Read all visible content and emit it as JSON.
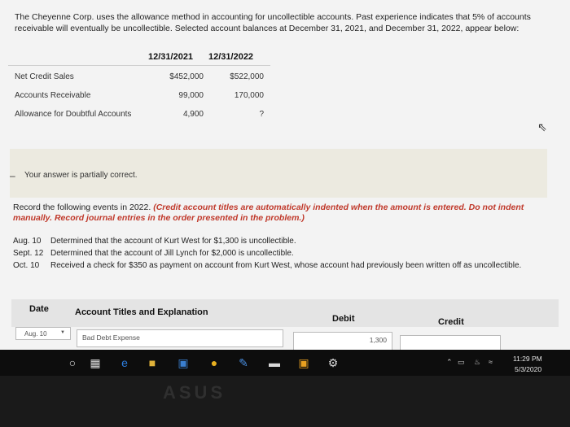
{
  "intro": "The Cheyenne Corp. uses the allowance method in accounting for uncollectible accounts. Past experience indicates that 5% of accounts receivable will eventually be uncollectible. Selected account balances at December 31, 2021, and December 31, 2022, appear below:",
  "balances": {
    "headers": [
      "12/31/2021",
      "12/31/2022"
    ],
    "rows": [
      {
        "label": "Net Credit Sales",
        "v2021": "$452,000",
        "v2022": "$522,000"
      },
      {
        "label": "Accounts Receivable",
        "v2021": "99,000",
        "v2022": "170,000"
      },
      {
        "label": "Allowance for Doubtful Accounts",
        "v2021": "4,900",
        "v2022": "?"
      }
    ]
  },
  "feedback": {
    "status": "Your answer is partially correct."
  },
  "instructions": {
    "lead": "Record the following events in 2022.",
    "note": "(Credit account titles are automatically indented when the amount is entered. Do not indent manually. Record journal entries in the order presented in the problem.)"
  },
  "events": [
    {
      "date": "Aug. 10",
      "text": "Determined that the account of Kurt West for $1,300 is uncollectible."
    },
    {
      "date": "Sept. 12",
      "text": "Determined that the account of Jill Lynch for $2,000 is uncollectible."
    },
    {
      "date": "Oct. 10",
      "text": "Received a check for $350 as payment on account from Kurt West, whose account had previously been written off as uncollectible."
    }
  ],
  "journal": {
    "headers": {
      "date": "Date",
      "account": "Account Titles and Explanation",
      "debit": "Debit",
      "credit": "Credit"
    },
    "rows": [
      {
        "date": "Aug. 10",
        "account": "Bad Debt Expense",
        "debit": "1,300",
        "credit": ""
      }
    ]
  },
  "taskbar": {
    "time": "11:29 PM",
    "date": "5/3/2020"
  },
  "bezel": {
    "brand": "ASUS"
  }
}
